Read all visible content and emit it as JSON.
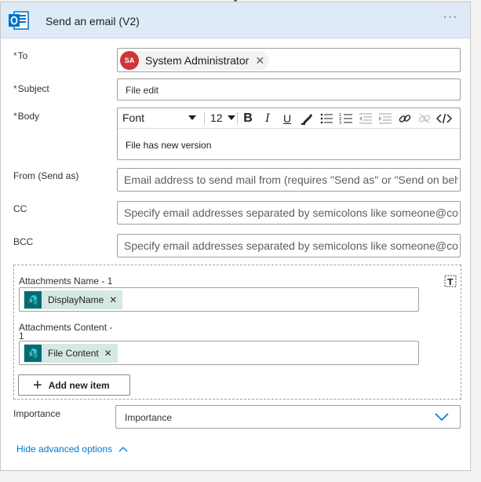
{
  "header": {
    "title": "Send an email (V2)",
    "more_label": "···"
  },
  "to": {
    "label": "To",
    "required_mark": "*",
    "recipient_initials": "SA",
    "recipient_name": "System Administrator",
    "remove_label": "✕"
  },
  "subject": {
    "label": "Subject",
    "required_mark": "*",
    "value": "File edit"
  },
  "body": {
    "label": "Body",
    "required_mark": "*",
    "font_value": "Font",
    "size_value": "12",
    "content": "File has new version"
  },
  "from": {
    "label": "From (Send as)",
    "placeholder": "Email address to send mail from (requires \"Send as\" or \"Send on beh"
  },
  "cc": {
    "label": "CC",
    "placeholder": "Specify email addresses separated by semicolons like someone@con"
  },
  "bcc": {
    "label": "BCC",
    "placeholder": "Specify email addresses separated by semicolons like someone@con"
  },
  "attachments": {
    "name_label": "Attachments Name - 1",
    "name_token": "DisplayName",
    "content_label_line1": "Attachments Content -",
    "content_label_line2": "1",
    "content_token": "File Content",
    "token_remove": "✕",
    "add_item_label": "Add new item"
  },
  "importance": {
    "label": "Importance",
    "value": "Importance"
  },
  "advanced": {
    "toggle_label": "Hide advanced options"
  },
  "colors": {
    "accent": "#0078d4",
    "header_bg": "#dfeaf7",
    "avatar": "#d13438",
    "required": "#a4262c",
    "token_bg": "#d5e8e4",
    "sharepoint": "#036c70"
  }
}
